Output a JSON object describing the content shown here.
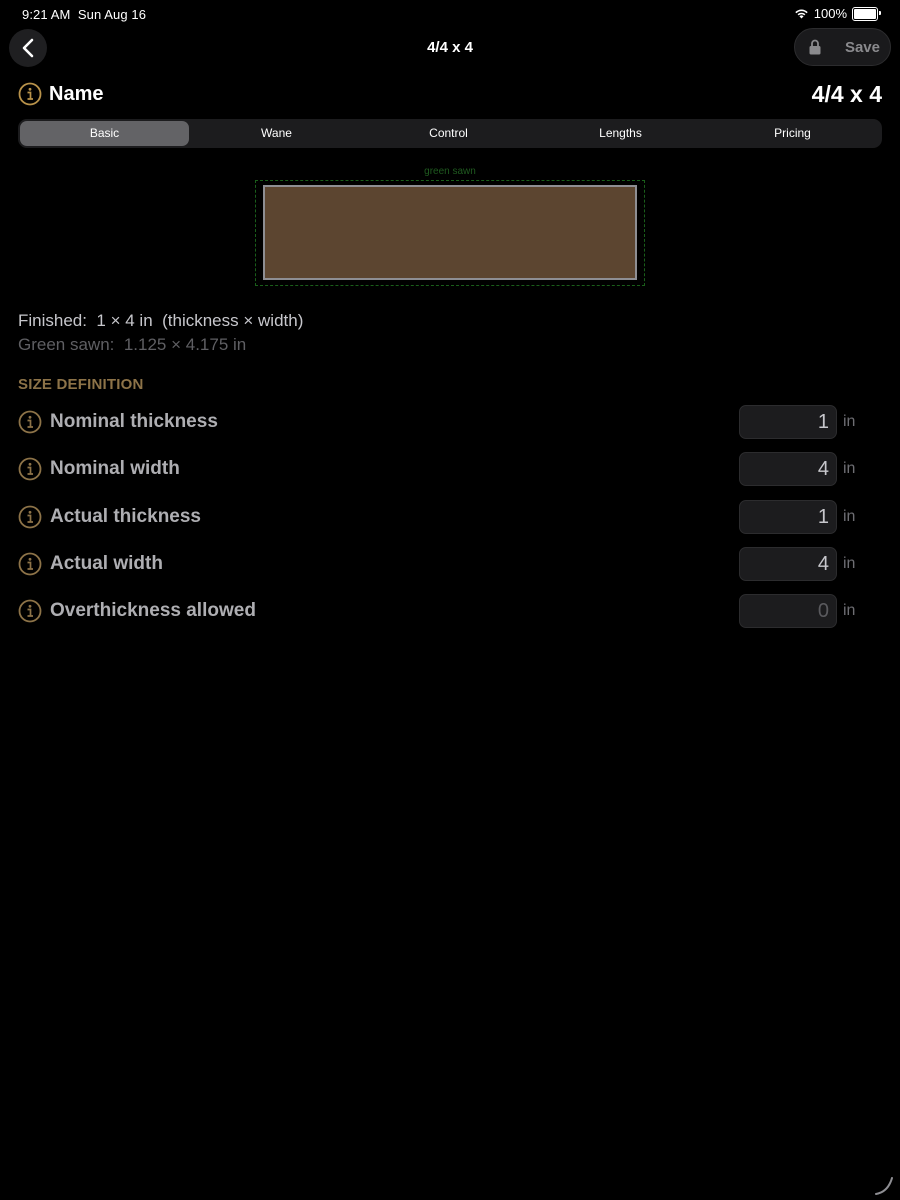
{
  "status_bar": {
    "time": "9:21 AM",
    "date": "Sun Aug 16",
    "battery": "100%",
    "battery_level": 1.0
  },
  "nav": {
    "title": "4/4 x 4",
    "save_label": "Save"
  },
  "name": {
    "label": "Name",
    "value": "4/4 x 4"
  },
  "tabs": [
    {
      "label": "Basic",
      "active": true
    },
    {
      "label": "Wane",
      "active": false
    },
    {
      "label": "Control",
      "active": false
    },
    {
      "label": "Lengths",
      "active": false
    },
    {
      "label": "Pricing",
      "active": false
    }
  ],
  "diagram": {
    "green_label": "green sawn"
  },
  "summary": {
    "finished": "Finished:  1 × 4 in  (thickness × width)",
    "green_sawn": "Green sawn:  1.125 × 4.175 in"
  },
  "section": {
    "header": "SIZE DEFINITION"
  },
  "fields": [
    {
      "label": "Nominal thickness",
      "value": "1",
      "unit": "in"
    },
    {
      "label": "Nominal width",
      "value": "4",
      "unit": "in"
    },
    {
      "label": "Actual thickness",
      "value": "1",
      "unit": "in"
    },
    {
      "label": "Actual width",
      "value": "4",
      "unit": "in"
    },
    {
      "label": "Overthickness allowed",
      "value": "0",
      "unit": "in"
    }
  ],
  "colors": {
    "accent": "#b8924a",
    "wood": "#5c4530",
    "green_outline": "#1a5e1a",
    "section_header": "#8d7348"
  },
  "icons": {
    "back": "chevron-left-icon",
    "lock": "lock-icon",
    "info": "info-circle-icon",
    "wifi": "wifi-icon",
    "battery": "battery-icon",
    "resize": "resize-handle-icon"
  }
}
